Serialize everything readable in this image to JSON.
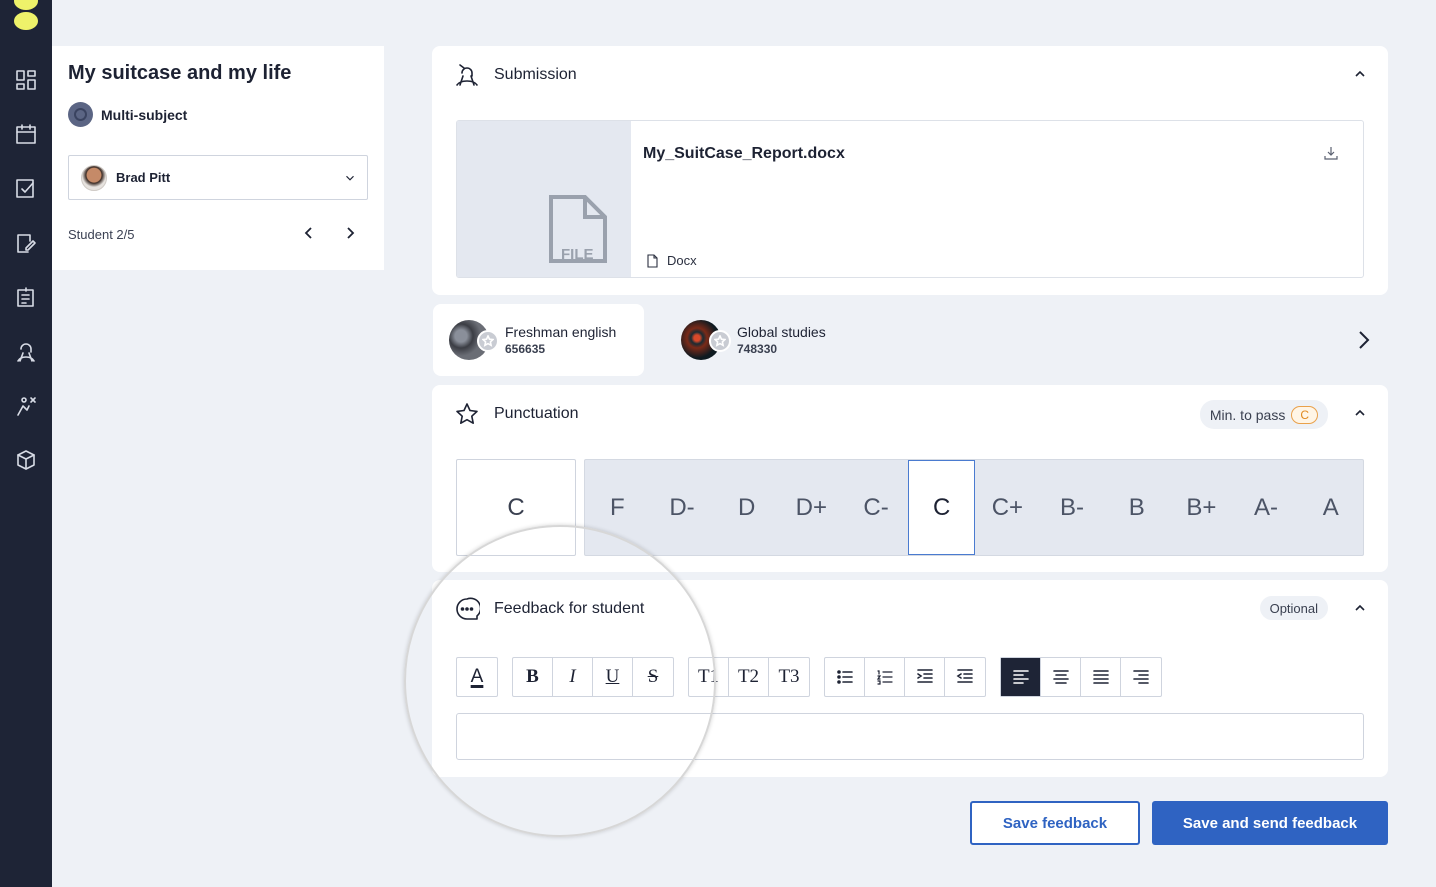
{
  "rail": {
    "icons": [
      "dashboard-icon",
      "calendar-icon",
      "task-check-icon",
      "edit-document-icon",
      "report-icon",
      "assessment-icon",
      "skills-icon",
      "package-icon"
    ]
  },
  "assignment": {
    "title": "My suitcase and my life",
    "subject": "Multi-subject",
    "student_name": "Brad Pitt",
    "student_count": "Student 2/5"
  },
  "submission": {
    "heading": "Submission",
    "file_name": "My_SuitCase_Report.docx",
    "file_type": "Docx",
    "thumb_label": "FILE"
  },
  "subjects": [
    {
      "name": "Freshman english",
      "code": "656635"
    },
    {
      "name": "Global studies",
      "code": "748330"
    }
  ],
  "punctuation": {
    "heading": "Punctuation",
    "min_label": "Min. to pass",
    "min_grade": "C",
    "selected": "C",
    "scale": [
      "F",
      "D-",
      "D",
      "D+",
      "C-",
      "C",
      "C+",
      "B-",
      "B",
      "B+",
      "A-",
      "A"
    ]
  },
  "feedback": {
    "heading": "Feedback for student",
    "optional_label": "Optional",
    "text_color_label": "A",
    "format": [
      "B",
      "I",
      "U",
      "S"
    ],
    "headings": [
      "T1",
      "T2",
      "T3"
    ],
    "editor_value": ""
  },
  "actions": {
    "save": "Save feedback",
    "save_send": "Save and send feedback"
  }
}
